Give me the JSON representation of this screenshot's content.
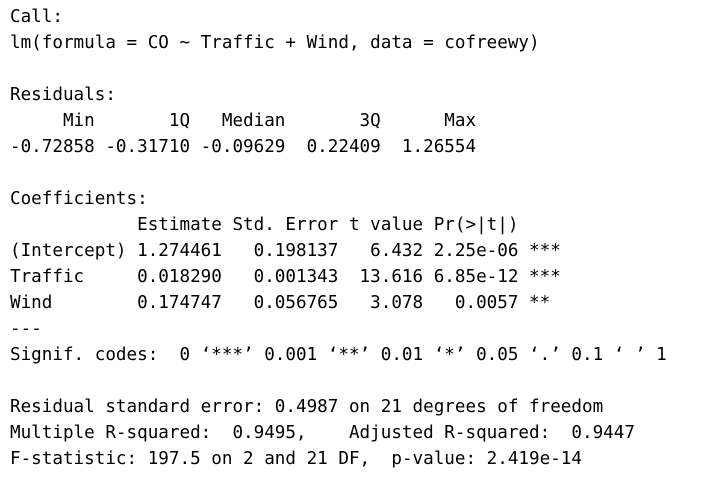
{
  "output": {
    "call_header": "Call:",
    "call_formula": "lm(formula = CO ~ Traffic + Wind, data = cofreewy)",
    "residuals_header": "Residuals:",
    "residuals_labels": "     Min       1Q   Median       3Q      Max ",
    "residuals_values": "-0.72858 -0.31710 -0.09629  0.22409  1.26554 ",
    "coefficients_header": "Coefficients:",
    "coef_table_header": "            Estimate Std. Error t value Pr(>|t|)    ",
    "coef_rows": [
      "(Intercept) 1.274461   0.198137   6.432 2.25e-06 ***",
      "Traffic     0.018290   0.001343  13.616 6.85e-12 ***",
      "Wind        0.174747   0.056765   3.078   0.0057 ** "
    ],
    "separator": "---",
    "signif_codes": "Signif. codes:  0 ‘***’ 0.001 ‘**’ 0.01 ‘*’ 0.05 ‘.’ 0.1 ‘ ’ 1",
    "residual_se": "Residual standard error: 0.4987 on 21 degrees of freedom",
    "r_squared": "Multiple R-squared:  0.9495,\tAdjusted R-squared:  0.9447 ",
    "f_statistic": "F-statistic: 197.5 on 2 and 21 DF,  p-value: 2.419e-14"
  }
}
